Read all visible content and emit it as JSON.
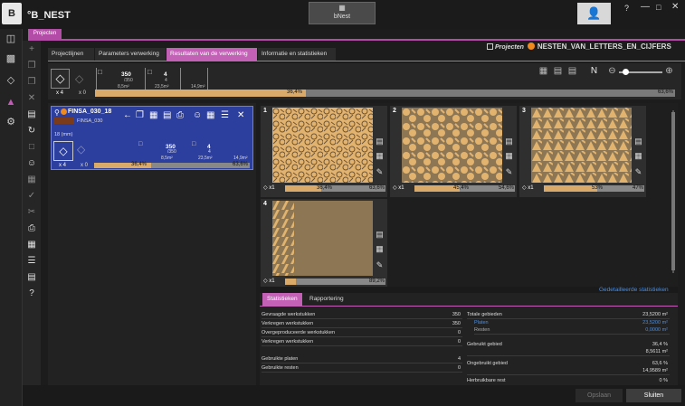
{
  "titlebar": {
    "logo": "B",
    "app_name": "°B_NEST",
    "center_button_label": "bNest",
    "help": "?",
    "minimize": "—",
    "maximize": "□",
    "close": "✕"
  },
  "project_tab": "Projecten",
  "tabs": [
    "Projectlijnen",
    "Parameters verwerking",
    "Resultaten van de verwerking",
    "Informatie en statistieken"
  ],
  "project_header": {
    "label": "Projecten",
    "name": "NESTEN_VAN_LETTERS_EN_CIJFERS"
  },
  "summary": {
    "count_left": "x 4",
    "count_right": "x 0",
    "box1_top": "350",
    "box1_sub": "/350",
    "box1_area": "8,5m²",
    "box2_top": "4",
    "box2_sub": "4",
    "box2_area": "23,5m²",
    "box3_area": "14,9m²",
    "bar_pct": 36.4,
    "bar_left": "36,4%",
    "bar_right": "63,6%"
  },
  "part_card": {
    "name": "FINSA_030_18",
    "material": "FINSA_030",
    "thickness": "18 (mm)",
    "count_left": "x 4",
    "count_right": "x 0",
    "box1_top": "350",
    "box1_sub": "/350",
    "box1_area": "8,5m²",
    "box2_top": "4",
    "box2_sub": "4",
    "box2_area": "23,5m²",
    "box3_area": "14,9m²",
    "bar_pct": 36.4,
    "bar_left": "36,4%",
    "bar_right": "63,6%"
  },
  "nests": [
    {
      "num": "1",
      "qty": "x1",
      "pct": 36.4,
      "left": "36,4%",
      "right": "63,6%"
    },
    {
      "num": "2",
      "qty": "x1",
      "pct": 45.4,
      "left": "45,4%",
      "right": "54,6%"
    },
    {
      "num": "3",
      "qty": "x1",
      "pct": 53,
      "left": "53%",
      "right": "47%"
    },
    {
      "num": "4",
      "qty": "x1",
      "pct": 10.8,
      "left": "",
      "right": "89,2%"
    }
  ],
  "details_link": "Gedetailleerde statistieken",
  "stats_tabs": [
    "Statistieken",
    "Rapportering"
  ],
  "stats_left": [
    {
      "label": "Gevraagde werkstukken",
      "value": "350"
    },
    {
      "label": "Verkregen werkstukken",
      "value": "350"
    },
    {
      "label": "Overgeproduceerde werkstukken",
      "value": "0"
    },
    {
      "label": "Verkregen werkstukken",
      "value": "0"
    },
    {
      "label": "Gebruikte platen",
      "value": "4"
    },
    {
      "label": "Gebruikte resten",
      "value": "0"
    }
  ],
  "stats_right": {
    "total_label": "Totale gebieden",
    "total_value": "23,5200 m²",
    "plates_label": "Platen",
    "plates_value": "23,5200 m²",
    "rests_label": "Resten",
    "rests_value": "0,0000 m²",
    "used_label": "Gebruikt gebied",
    "used_pct": "36,4 %",
    "used_value": "8,5611 m²",
    "unused_label": "Ongebruikt gebied",
    "unused_pct": "63,6 %",
    "unused_value": "14,9589 m²",
    "reusable_label": "Herbruikbare rest",
    "reusable_value": "0 %"
  },
  "footer": {
    "save": "Opslaan",
    "close": "Sluiten"
  },
  "colors": {
    "accent": "#c261b6",
    "fill": "#d9aa6a",
    "card": "#2c3e9e",
    "material": "#a67c52"
  }
}
